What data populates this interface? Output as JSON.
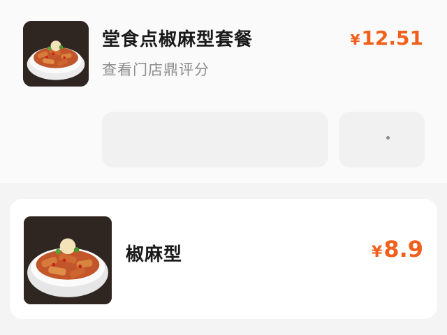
{
  "combo_item": {
    "name": "堂食点椒麻型套餐",
    "subtitle": "查看门店鼎评分",
    "price_currency": "¥",
    "price_value": "12.51",
    "image_icon": "dish-photo-icon"
  },
  "single_item": {
    "name": "椒麻型",
    "price_currency": "¥",
    "price_value": "8.9",
    "image_icon": "dish-photo-icon"
  },
  "colors": {
    "price": "#f0601c",
    "title": "#1a1a1a",
    "subtitle": "#8c8c8c",
    "placeholder": "#f1f1f1",
    "card_bg": "#ffffff",
    "page_bg": "#f4f4f4"
  }
}
